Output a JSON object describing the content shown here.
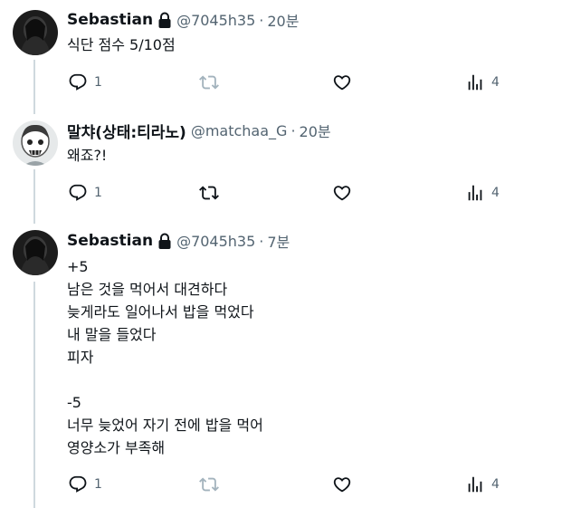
{
  "tweets": [
    {
      "name": "Sebastian",
      "handle": "@7045h35",
      "separator": "·",
      "time": "20분",
      "lines": [
        "식단 점수 5/10점"
      ],
      "reply_count": "1",
      "view_count": "4"
    },
    {
      "name": "말챠(상태:티라노)",
      "handle": "@matchaa_G",
      "separator": "·",
      "time": "20분",
      "lines": [
        "왜죠?!"
      ],
      "reply_count": "1",
      "view_count": "4"
    },
    {
      "name": "Sebastian",
      "handle": "@7045h35",
      "separator": "·",
      "time": "7분",
      "lines": [
        "+5",
        "남은 것을 먹어서 대견하다",
        "늦게라도 일어나서 밥을 먹었다",
        "내 말을 들었다",
        "피자",
        "",
        "-5",
        "너무 늦었어 자기 전에 밥을 먹어",
        "영양소가 부족해"
      ],
      "reply_count": "1",
      "view_count": "4"
    }
  ],
  "icons": {
    "reply": "reply-icon",
    "retweet": "retweet-icon",
    "like": "heart-icon",
    "views": "views-chart-icon",
    "lock": "lock-icon"
  },
  "colors": {
    "text": "#0f1419",
    "secondary": "#536471",
    "thread_line": "#cfd9de",
    "retweet_disabled": "#a3b3bd"
  }
}
